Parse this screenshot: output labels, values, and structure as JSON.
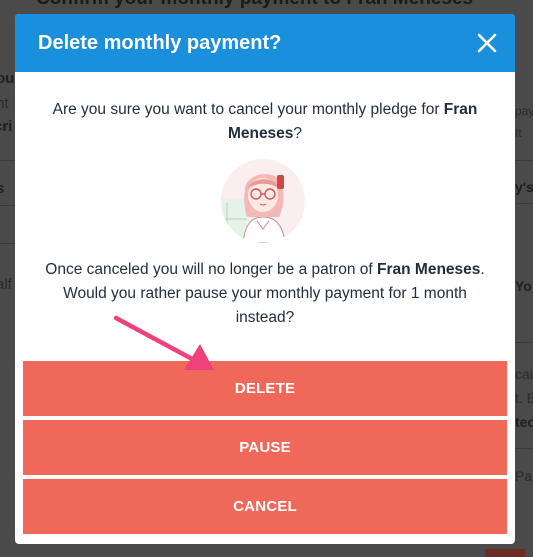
{
  "background": {
    "title_fragment": "Confirm your monthly payment to Fran Meneses",
    "left_fragments": [
      "ou",
      "nt",
      "cri",
      "s",
      "alf"
    ],
    "right_fragments": [
      "pay",
      "It",
      "y's",
      "Yo",
      "cai",
      "t. B",
      "tec",
      "Pa"
    ]
  },
  "modal": {
    "title": "Delete monthly payment?",
    "question_prefix": "Are you sure you want to cancel your monthly pledge for ",
    "creator_name": "Fran Meneses",
    "question_suffix": "?",
    "notice_prefix": "Once canceled you will no longer be a patron of ",
    "notice_creator": "Fran Meneses",
    "notice_suffix": ". Would you rather pause your monthly payment for 1 month instead?",
    "buttons": {
      "delete": "DELETE",
      "pause": "PAUSE",
      "cancel": "CANCEL"
    }
  },
  "colors": {
    "header": "#1a8fdb",
    "button": "#f0685a",
    "arrow": "#f0417a"
  }
}
